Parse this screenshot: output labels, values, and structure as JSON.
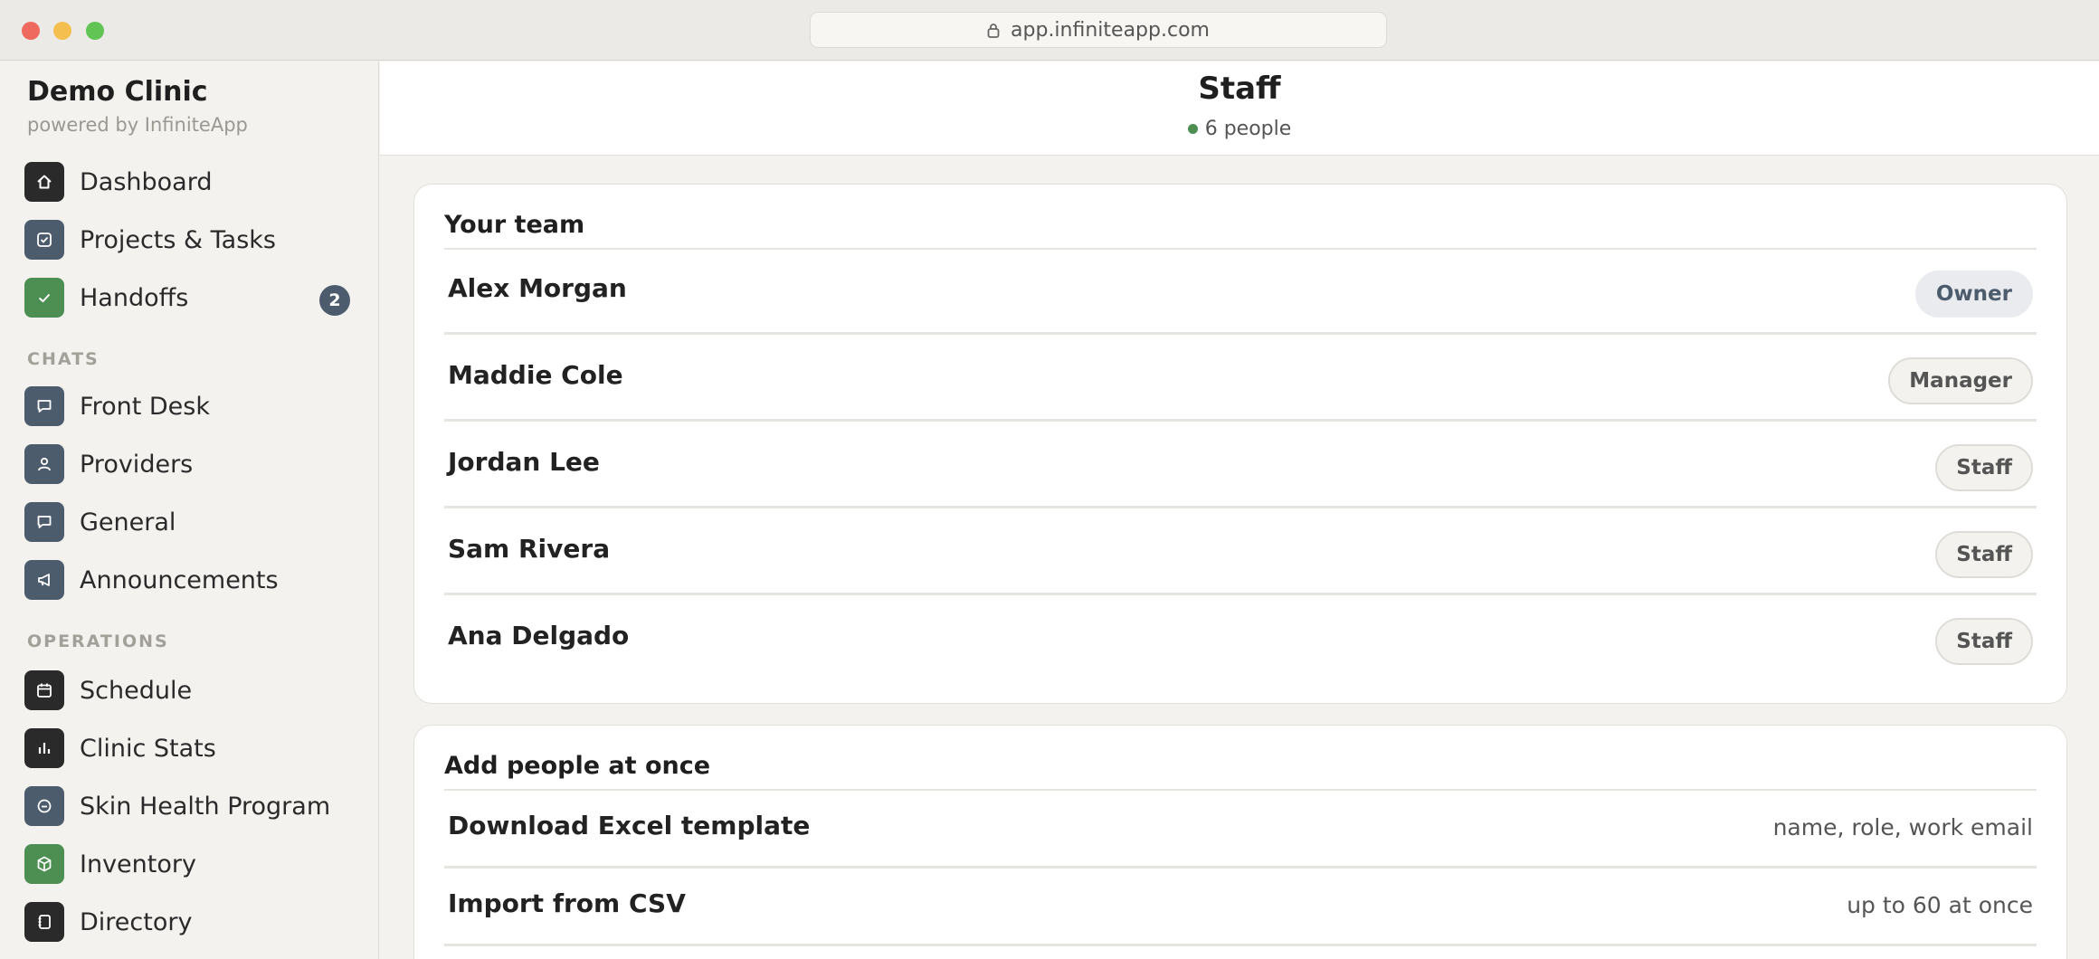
{
  "browser": {
    "url": "app.infiniteapp.com"
  },
  "sidebar": {
    "brand": "Demo Clinic",
    "brand_sub": "powered by InfiniteApp",
    "main_items": [
      {
        "label": "Dashboard",
        "icon": "home-icon"
      },
      {
        "label": "Projects & Tasks",
        "icon": "checkbox-icon"
      },
      {
        "label": "Handoffs",
        "icon": "check-icon",
        "badge": "2"
      }
    ],
    "chats_label": "CHATS",
    "chat_items": [
      {
        "label": "Front Desk",
        "icon": "chat-bubble-icon"
      },
      {
        "label": "Providers",
        "icon": "person-icon"
      },
      {
        "label": "General",
        "icon": "chat-bubble-icon"
      },
      {
        "label": "Announcements",
        "icon": "megaphone-icon"
      }
    ],
    "operations_label": "OPERATIONS",
    "operation_items": [
      {
        "label": "Schedule",
        "icon": "calendar-icon"
      },
      {
        "label": "Clinic Stats",
        "icon": "bar-chart-icon"
      },
      {
        "label": "Skin Health Program",
        "icon": "circle-minus-icon"
      },
      {
        "label": "Inventory",
        "icon": "box-icon"
      },
      {
        "label": "Directory",
        "icon": "contacts-book-icon"
      }
    ]
  },
  "header": {
    "title": "Staff",
    "subtitle": "6 people"
  },
  "team": {
    "title": "Your team",
    "members": [
      {
        "name": "Alex Morgan",
        "role": "Owner"
      },
      {
        "name": "Maddie Cole",
        "role": "Manager"
      },
      {
        "name": "Jordan Lee",
        "role": "Staff"
      },
      {
        "name": "Sam Rivera",
        "role": "Staff"
      },
      {
        "name": "Ana Delgado",
        "role": "Staff"
      }
    ]
  },
  "bulk": {
    "title": "Add people at once",
    "actions": [
      {
        "label": "Download Excel template",
        "hint": "name, role, work email"
      },
      {
        "label": "Import from CSV",
        "hint": "up to 60 at once"
      }
    ]
  },
  "colors": {
    "slate": "#4d5c6d",
    "green": "#4d8f52",
    "dark": "#2a2a2a"
  }
}
